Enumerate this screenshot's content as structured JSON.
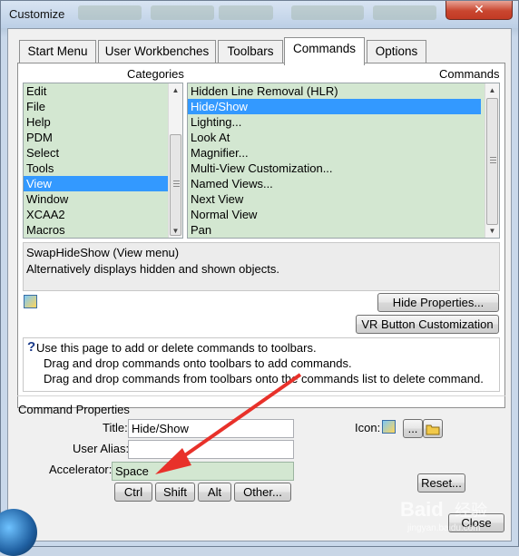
{
  "window": {
    "title": "Customize",
    "close_glyph": "✕"
  },
  "tabs": [
    {
      "label": "Start Menu"
    },
    {
      "label": "User Workbenches"
    },
    {
      "label": "Toolbars"
    },
    {
      "label": "Commands"
    },
    {
      "label": "Options"
    }
  ],
  "categories": {
    "header": "Categories",
    "items": [
      "Edit",
      "File",
      "Help",
      "PDM",
      "Select",
      "Tools",
      "View",
      "Window",
      "XCAA2",
      "Macros"
    ],
    "selected": "View"
  },
  "commands": {
    "header": "Commands",
    "items": [
      "Hidden Line Removal (HLR)",
      "Hide/Show",
      "Lighting...",
      "Look At",
      "Magnifier...",
      "Multi-View Customization...",
      "Named Views...",
      "Next View",
      "Normal View",
      "Pan"
    ],
    "selected": "Hide/Show"
  },
  "description": {
    "line1": "SwapHideShow (View menu)",
    "line2": "Alternatively displays hidden and shown objects."
  },
  "buttons": {
    "hide_properties": "Hide Properties...",
    "vr_button": "VR Button Customization",
    "ctrl": "Ctrl",
    "shift": "Shift",
    "alt": "Alt",
    "other": "Other...",
    "reset": "Reset...",
    "close": "Close",
    "browse": "...",
    "glyph_help": "?"
  },
  "info": {
    "line1": "Use this page to add or delete commands to toolbars.",
    "line2": "Drag and drop commands onto toolbars to add commands.",
    "line3": "Drag and drop commands from toolbars onto the commands list to delete command."
  },
  "command_properties": {
    "group_title": "Command Properties",
    "title_label": "Title:",
    "title_value": "Hide/Show",
    "alias_label": "User Alias:",
    "alias_value": "",
    "accel_label": "Accelerator:",
    "accel_value": "Space",
    "icon_label": "Icon:"
  },
  "colors": {
    "list_bg": "#d3e7d1",
    "selection": "#3399ff",
    "annotation_arrow": "#e8312a"
  },
  "watermark": {
    "text1": "Baid",
    "text2": "经验",
    "text3": "jingyan.baidu.com"
  }
}
